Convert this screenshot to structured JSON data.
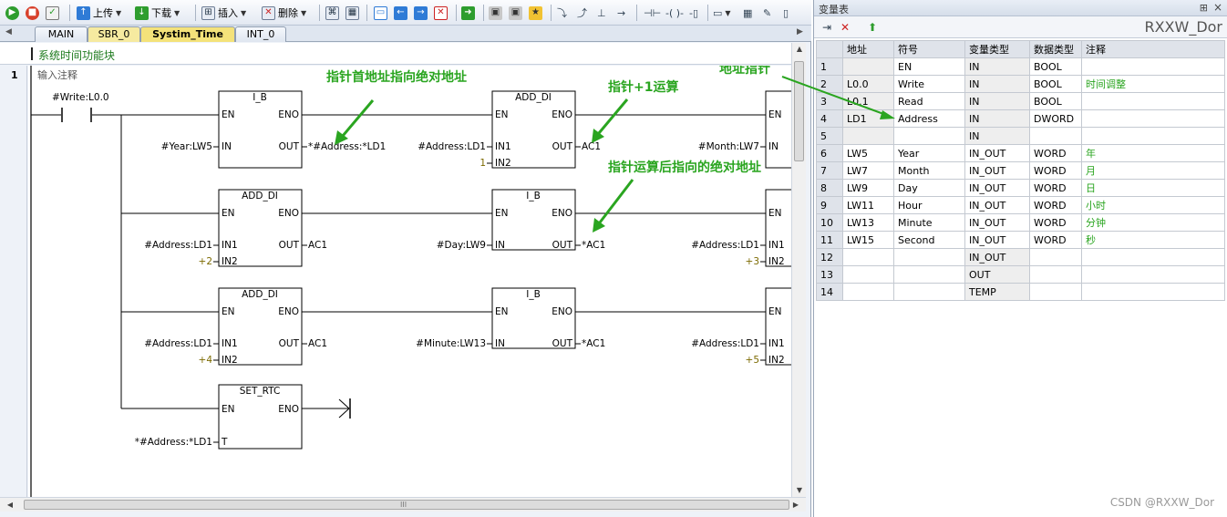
{
  "toolbar": {
    "upload": "上传",
    "download": "下载",
    "insert": "插入",
    "delete": "删除"
  },
  "tabs": [
    "MAIN",
    "SBR_0",
    "Systim_Time",
    "INT_0"
  ],
  "pou": {
    "title": "系统时间功能块",
    "network_number": "1",
    "network_comment": "输入注释"
  },
  "ladder": {
    "contact": "#Write:L0.0",
    "block1": {
      "name": "I_B",
      "en": "EN",
      "eno": "ENO",
      "in": "IN",
      "out": "OUT",
      "in_val": "#Year:LW5",
      "out_val": "*#Address:*LD1"
    },
    "block2": {
      "name": "ADD_DI",
      "en": "EN",
      "eno": "ENO",
      "in1": "IN1",
      "in2": "IN2",
      "out": "OUT",
      "in1_val": "#Address:LD1",
      "in2_val": "1",
      "out_val": "AC1"
    },
    "block3": {
      "name": "ADD_DI",
      "en": "EN",
      "eno": "ENO",
      "in1": "IN1",
      "in2": "IN2",
      "out": "OUT",
      "in1_val": "#Address:LD1",
      "in2_val": "+2",
      "out_val": "AC1"
    },
    "block4": {
      "name": "I_B",
      "en": "EN",
      "eno": "ENO",
      "in": "IN",
      "out": "OUT",
      "in_val": "#Day:LW9",
      "out_val": "*AC1"
    },
    "block5": {
      "name": "ADD_DI",
      "en": "EN",
      "eno": "ENO",
      "in1": "IN1",
      "in2": "IN2",
      "out": "OUT",
      "in1_val": "#Address:LD1",
      "in2_val": "+4",
      "out_val": "AC1"
    },
    "block6": {
      "name": "I_B",
      "en": "EN",
      "eno": "ENO",
      "in": "IN",
      "out": "OUT",
      "in_val": "#Minute:LW13",
      "out_val": "*AC1"
    },
    "block7": {
      "name": "SET_RTC",
      "en": "EN",
      "eno": "ENO",
      "t": "T",
      "t_val": "*#Address:*LD1"
    },
    "edge_block_top": {
      "en": "EN",
      "in": "IN",
      "in_val": "#Month:LW7"
    },
    "edge_block_row2": {
      "en": "EN",
      "in1": "IN1",
      "in2": "IN2",
      "in1_val": "#Address:LD1",
      "in2_val": "+3"
    },
    "edge_block_row3": {
      "en": "EN",
      "in1": "IN1",
      "in2": "IN2",
      "in1_val": "#Address:LD1",
      "in2_val": "+5"
    }
  },
  "annotations": {
    "pointer_first": "指针首地址指向绝对地址",
    "pointer_plus": "指针+1运算",
    "pointer_after": "指针运算后指向的绝对地址",
    "address_pointer": "地址指针",
    "color": "#2aa520"
  },
  "vartable": {
    "title": "变量表",
    "brand": "RXXW_Dor",
    "headers": [
      "",
      "地址",
      "符号",
      "变量类型",
      "数据类型",
      "注释"
    ],
    "rows": [
      [
        "1",
        "",
        "EN",
        "IN",
        "BOOL",
        ""
      ],
      [
        "2",
        "L0.0",
        "Write",
        "IN",
        "BOOL",
        "时间调整"
      ],
      [
        "3",
        "L0.1",
        "Read",
        "IN",
        "BOOL",
        ""
      ],
      [
        "4",
        "LD1",
        "Address",
        "IN",
        "DWORD",
        ""
      ],
      [
        "5",
        "",
        "",
        "IN",
        "",
        ""
      ],
      [
        "6",
        "LW5",
        "Year",
        "IN_OUT",
        "WORD",
        "年"
      ],
      [
        "7",
        "LW7",
        "Month",
        "IN_OUT",
        "WORD",
        "月"
      ],
      [
        "8",
        "LW9",
        "Day",
        "IN_OUT",
        "WORD",
        "日"
      ],
      [
        "9",
        "LW11",
        "Hour",
        "IN_OUT",
        "WORD",
        "小时"
      ],
      [
        "10",
        "LW13",
        "Minute",
        "IN_OUT",
        "WORD",
        "分钟"
      ],
      [
        "11",
        "LW15",
        "Second",
        "IN_OUT",
        "WORD",
        "秒"
      ],
      [
        "12",
        "",
        "",
        "IN_OUT",
        "",
        ""
      ],
      [
        "13",
        "",
        "",
        "OUT",
        "",
        ""
      ],
      [
        "14",
        "",
        "",
        "TEMP",
        "",
        ""
      ]
    ]
  },
  "watermark": "CSDN @RXXW_Dor"
}
